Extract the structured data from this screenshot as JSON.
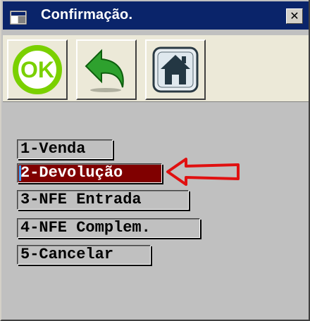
{
  "window": {
    "title": "Confirmação.",
    "close_glyph": "✕"
  },
  "toolbar": {
    "buttons": [
      {
        "name": "ok-button",
        "label": "OK",
        "icon": "ok-circle-icon"
      },
      {
        "name": "back-button",
        "icon": "undo-arrow-icon"
      },
      {
        "name": "home-button",
        "icon": "home-icon"
      }
    ]
  },
  "menu": {
    "items": [
      {
        "label": "1-Venda"
      },
      {
        "label": "2-Devolução",
        "selected": true
      },
      {
        "label": "3-NFE Entrada"
      },
      {
        "label": "4-NFE Complem."
      },
      {
        "label": "5-Cancelar"
      }
    ]
  },
  "annotation": {
    "icon": "red-arrow-left-icon",
    "color": "#e01010"
  },
  "colors": {
    "titlebar": "#0a246a",
    "selected_bg": "#800000",
    "ok_green": "#7ad000",
    "back_green": "#2ea12e"
  }
}
